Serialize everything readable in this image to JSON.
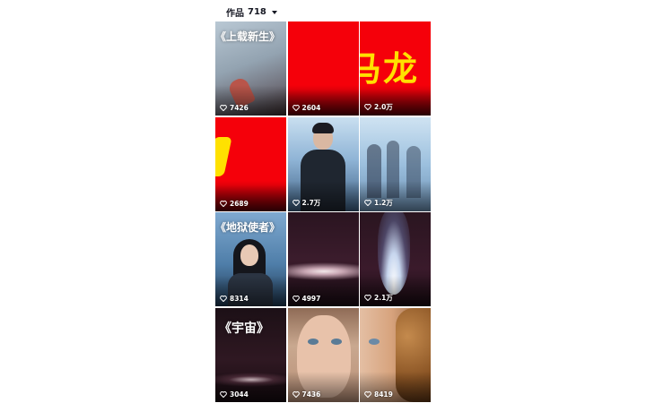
{
  "header": {
    "works_label": "作品",
    "works_count": "718"
  },
  "tiles": [
    {
      "likes": "7426",
      "title": "《上载新生》"
    },
    {
      "likes": "2604"
    },
    {
      "likes": "2.0万",
      "big_text": "马龙"
    },
    {
      "likes": "2689"
    },
    {
      "likes": "2.7万"
    },
    {
      "likes": "1.2万"
    },
    {
      "likes": "8314",
      "title": "《地狱使者》"
    },
    {
      "likes": "4997"
    },
    {
      "likes": "2.1万"
    },
    {
      "likes": "3044",
      "title": "《宇宙》"
    },
    {
      "likes": "7436"
    },
    {
      "likes": "8419"
    }
  ],
  "colors": {
    "red_bg": "#f5000a",
    "yellow_text": "#ffe100"
  }
}
